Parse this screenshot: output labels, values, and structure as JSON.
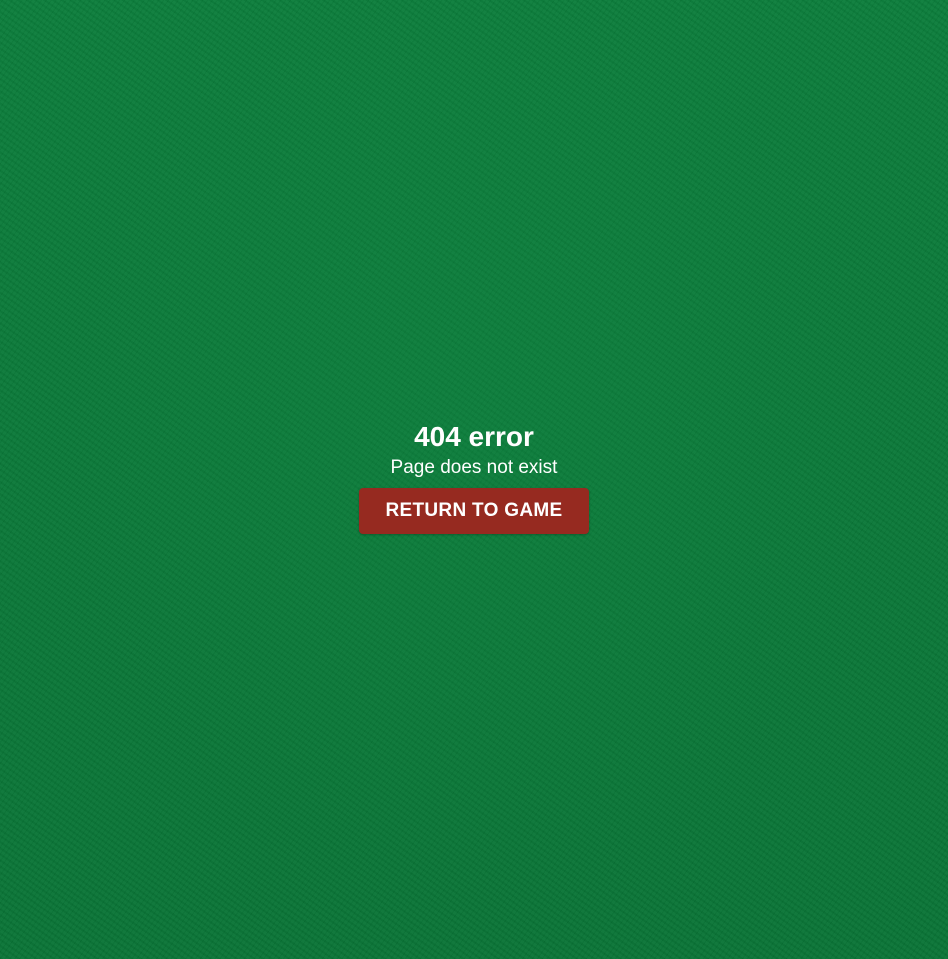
{
  "error": {
    "title": "404 error",
    "message": "Page does not exist",
    "button_label": "RETURN TO GAME"
  },
  "colors": {
    "background": "#0a7a3a",
    "button": "#962a20",
    "text": "#ffffff"
  }
}
